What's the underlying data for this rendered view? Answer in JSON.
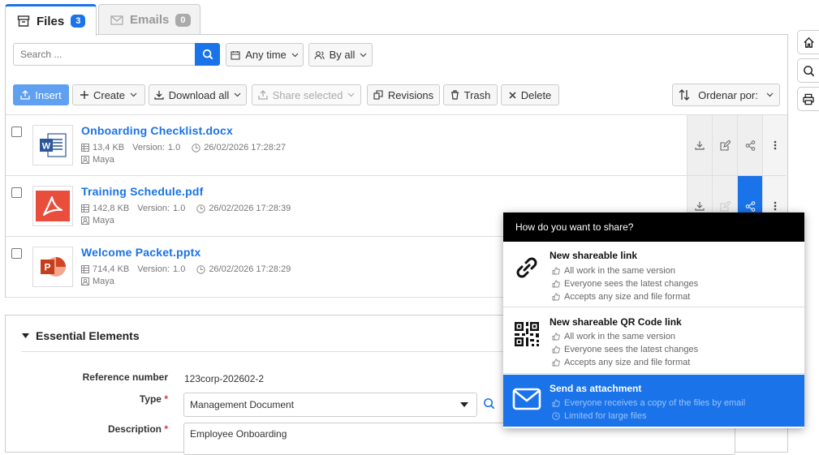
{
  "tabs": [
    {
      "label": "Files",
      "badge": "3"
    },
    {
      "label": "Emails",
      "badge": "0"
    }
  ],
  "search": {
    "placeholder": "Search ..."
  },
  "filters": {
    "time": "Any time",
    "by": "By all"
  },
  "toolbar": {
    "insert": "Insert",
    "create": "Create",
    "download_all": "Download all",
    "share_selected": "Share selected",
    "revisions": "Revisions",
    "trash": "Trash",
    "delete": "Delete",
    "sort": "Ordenar por:"
  },
  "files": [
    {
      "name": "Onboarding Checklist.docx",
      "size": "13,4 KB",
      "version_label": "Version:",
      "version": "1.0",
      "date": "26/02/2026 17:28:27",
      "owner": "Maya",
      "type": "word"
    },
    {
      "name": "Training Schedule.pdf",
      "size": "142,8 KB",
      "version_label": "Version:",
      "version": "1.0",
      "date": "26/02/2026 17:28:39",
      "owner": "Maya",
      "type": "pdf"
    },
    {
      "name": "Welcome Packet.pptx",
      "size": "714,4 KB",
      "version_label": "Version:",
      "version": "1.0",
      "date": "26/02/2026 17:28:29",
      "owner": "Maya",
      "type": "powerpoint"
    }
  ],
  "section": {
    "title": "Essential Elements",
    "reference_label": "Reference number",
    "reference_value": "123corp-202602-2",
    "type_label": "Type",
    "type_value": "Management Document",
    "description_label": "Description",
    "description_value": "Employee Onboarding",
    "required_mark": "*"
  },
  "share_popup": {
    "title": "How do you want to share?",
    "options": [
      {
        "title": "New shareable link",
        "lines": [
          "All work in the same version",
          "Everyone sees the latest changes",
          "Accepts any size and file format"
        ],
        "icon": "link-icon"
      },
      {
        "title": "New shareable QR Code link",
        "lines": [
          "All work in the same version",
          "Everyone sees the latest changes",
          "Accepts any size and file format"
        ],
        "icon": "qr-code-icon"
      },
      {
        "title": "Send as attachment",
        "lines": [
          "Everyone receives a copy of the files by email",
          "Limited for large files"
        ],
        "icon": "envelope-icon"
      }
    ]
  },
  "colors": {
    "accent": "#1a73e8",
    "badge_active": "#1a73e8",
    "badge_inactive": "#999999",
    "popup_header": "#000000",
    "selected_option": "#1a73e8"
  }
}
